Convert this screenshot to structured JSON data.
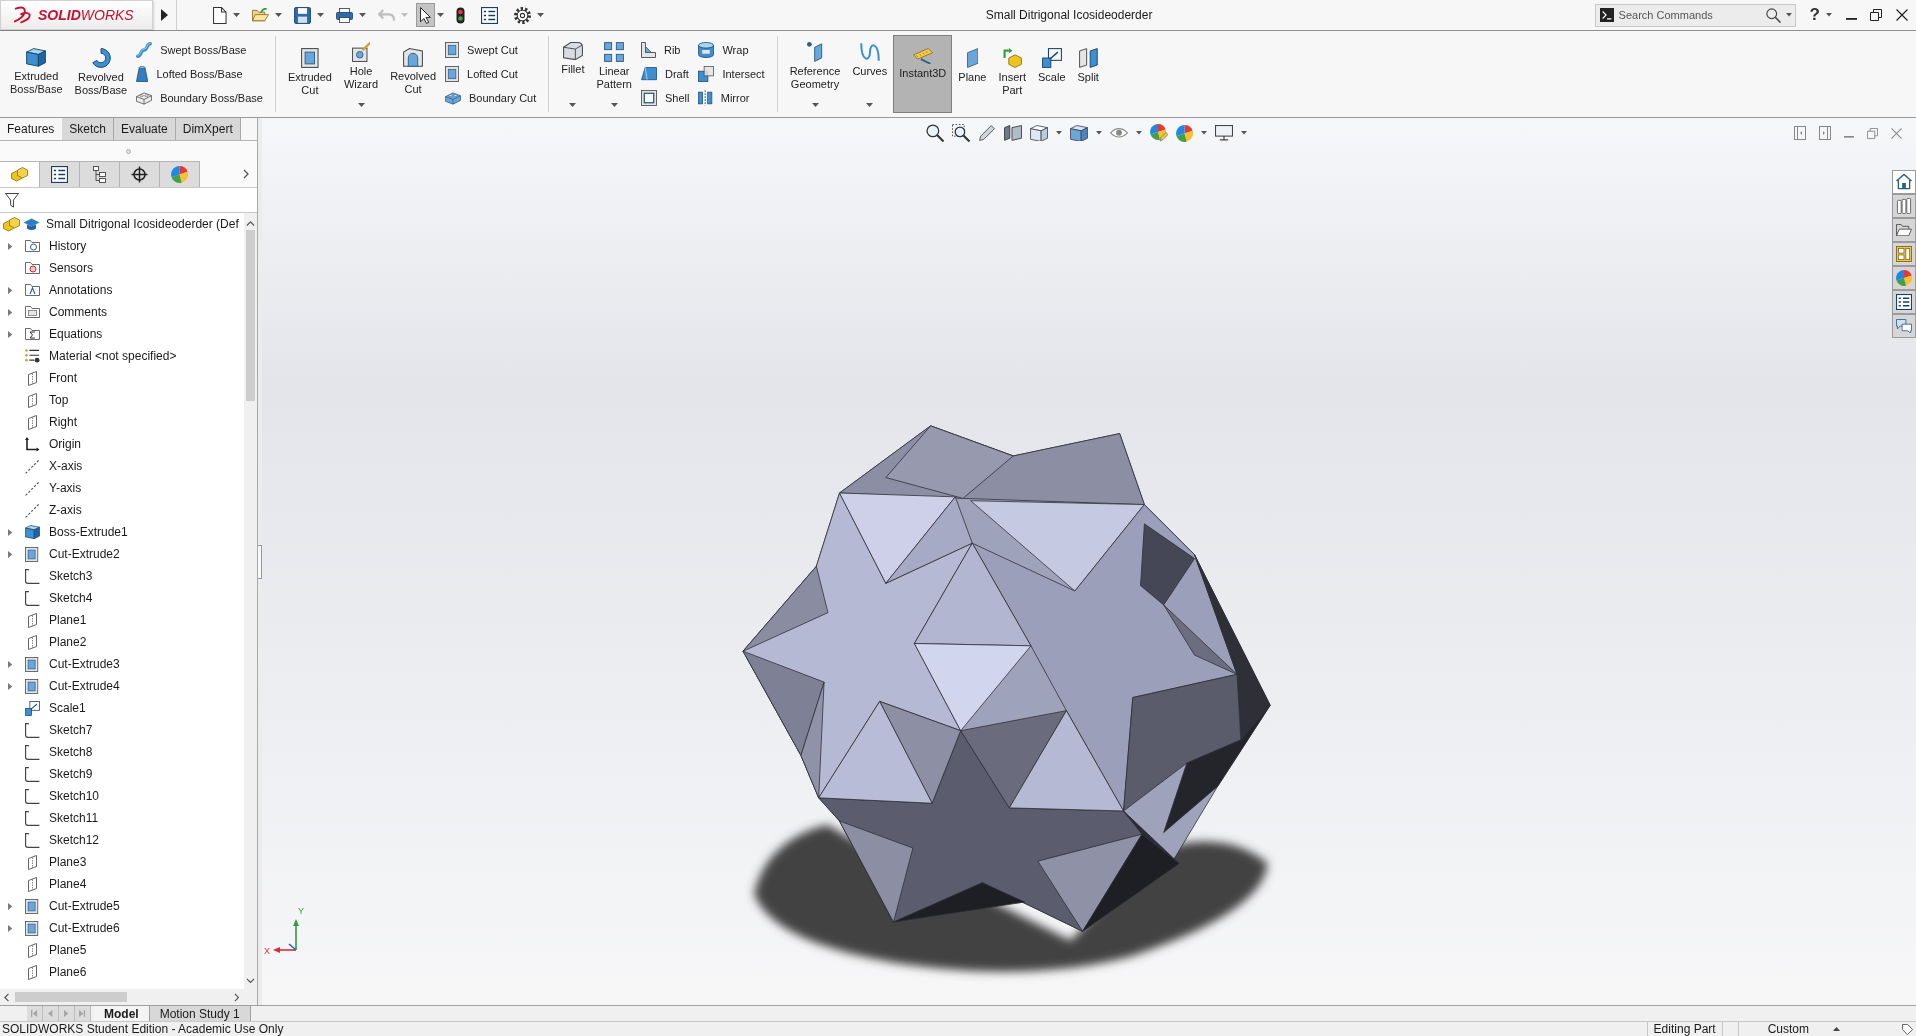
{
  "title_bar": {
    "logo_text": "**SOLID**WORKS",
    "document_title": "Small Ditrigonal Icosideoderder",
    "search": {
      "placeholder": "Search Commands"
    },
    "help": "?"
  },
  "quick_access": [
    {
      "kind": "new",
      "dropdown": true,
      "disabled": false,
      "selected": false
    },
    {
      "kind": "open",
      "dropdown": true,
      "disabled": false,
      "selected": false
    },
    {
      "kind": "save",
      "dropdown": true,
      "disabled": false,
      "selected": false
    },
    {
      "kind": "print",
      "dropdown": true,
      "disabled": false,
      "selected": false
    },
    {
      "kind": "undo",
      "dropdown": true,
      "disabled": true,
      "selected": false
    },
    {
      "kind": "select",
      "dropdown": true,
      "disabled": false,
      "selected": true
    },
    {
      "kind": "rebuild",
      "dropdown": false,
      "disabled": false,
      "selected": false
    },
    {
      "kind": "properties",
      "dropdown": false,
      "disabled": false,
      "selected": false
    },
    {
      "kind": "options",
      "dropdown": true,
      "disabled": false,
      "selected": false
    }
  ],
  "ribbon": [
    {
      "items": [
        {
          "kind": "large",
          "label": "Extruded Boss/Base",
          "dropdown": false,
          "selected": false
        },
        {
          "kind": "large",
          "label": "Revolved Boss/Base",
          "dropdown": false,
          "selected": false
        },
        {
          "kind": "stack",
          "items": [
            {
              "label": "Swept Boss/Base"
            },
            {
              "label": "Lofted Boss/Base"
            },
            {
              "label": "Boundary Boss/Base"
            }
          ]
        }
      ]
    },
    {
      "items": [
        {
          "kind": "large",
          "label": "Extruded Cut",
          "dropdown": false,
          "selected": false
        },
        {
          "kind": "large",
          "label": "Hole Wizard",
          "dropdown": true,
          "selected": false
        },
        {
          "kind": "large",
          "label": "Revolved Cut",
          "dropdown": false,
          "selected": false
        },
        {
          "kind": "stack",
          "items": [
            {
              "label": "Swept Cut"
            },
            {
              "label": "Lofted Cut"
            },
            {
              "label": "Boundary Cut"
            }
          ]
        }
      ]
    },
    {
      "items": [
        {
          "kind": "large",
          "label": "Fillet",
          "dropdown": true,
          "selected": false
        },
        {
          "kind": "large",
          "label": "Linear Pattern",
          "dropdown": true,
          "selected": false
        },
        {
          "kind": "stack",
          "items": [
            {
              "label": "Rib"
            },
            {
              "label": "Draft"
            },
            {
              "label": "Shell"
            }
          ]
        },
        {
          "kind": "stack",
          "items": [
            {
              "label": "Wrap"
            },
            {
              "label": "Intersect"
            },
            {
              "label": "Mirror"
            }
          ]
        }
      ]
    },
    {
      "items": [
        {
          "kind": "large",
          "label": "Reference Geometry",
          "dropdown": true,
          "selected": false
        },
        {
          "kind": "large",
          "label": "Curves",
          "dropdown": true,
          "selected": false
        },
        {
          "kind": "large",
          "label": "Instant3D",
          "dropdown": false,
          "selected": true
        },
        {
          "kind": "large",
          "label": "Plane",
          "dropdown": false,
          "selected": false
        },
        {
          "kind": "large",
          "label": "Insert Part",
          "dropdown": false,
          "selected": false
        },
        {
          "kind": "large",
          "label": "Scale",
          "dropdown": false,
          "selected": false
        },
        {
          "kind": "large",
          "label": "Split",
          "dropdown": false,
          "selected": false
        }
      ]
    }
  ],
  "command_tabs": [
    {
      "label": "Features",
      "selected": true
    },
    {
      "label": "Sketch",
      "selected": false
    },
    {
      "label": "Evaluate",
      "selected": false
    },
    {
      "label": "DimXpert",
      "selected": false
    }
  ],
  "panel_tabs": [
    {
      "selected": true
    },
    {
      "selected": false
    },
    {
      "selected": false
    },
    {
      "selected": false
    },
    {
      "selected": false
    }
  ],
  "feature_tree": {
    "label": "Small Ditrigonal Icosideoderder (Def",
    "children": [
      {
        "label": "History",
        "kind": "history",
        "expandable": true
      },
      {
        "label": "Sensors",
        "kind": "sensors",
        "expandable": false
      },
      {
        "label": "Annotations",
        "kind": "annotations",
        "expandable": true
      },
      {
        "label": "Comments",
        "kind": "comments",
        "expandable": true
      },
      {
        "label": "Equations",
        "kind": "equations",
        "expandable": true
      },
      {
        "label": "Material <not specified>",
        "kind": "material",
        "expandable": false
      },
      {
        "label": "Front",
        "kind": "plane",
        "expandable": false
      },
      {
        "label": "Top",
        "kind": "plane",
        "expandable": false
      },
      {
        "label": "Right",
        "kind": "plane",
        "expandable": false
      },
      {
        "label": "Origin",
        "kind": "origin",
        "expandable": false
      },
      {
        "label": "X-axis",
        "kind": "axis",
        "expandable": false
      },
      {
        "label": "Y-axis",
        "kind": "axis",
        "expandable": false
      },
      {
        "label": "Z-axis",
        "kind": "axis",
        "expandable": false
      },
      {
        "label": "Boss-Extrude1",
        "kind": "boss",
        "expandable": true
      },
      {
        "label": "Cut-Extrude2",
        "kind": "cut",
        "expandable": true
      },
      {
        "label": "Sketch3",
        "kind": "sketch",
        "expandable": false
      },
      {
        "label": "Sketch4",
        "kind": "sketch",
        "expandable": false
      },
      {
        "label": "Plane1",
        "kind": "plane",
        "expandable": false
      },
      {
        "label": "Plane2",
        "kind": "plane",
        "expandable": false
      },
      {
        "label": "Cut-Extrude3",
        "kind": "cut",
        "expandable": true
      },
      {
        "label": "Cut-Extrude4",
        "kind": "cut",
        "expandable": true
      },
      {
        "label": "Scale1",
        "kind": "scale",
        "expandable": false
      },
      {
        "label": "Sketch7",
        "kind": "sketch",
        "expandable": false
      },
      {
        "label": "Sketch8",
        "kind": "sketch",
        "expandable": false
      },
      {
        "label": "Sketch9",
        "kind": "sketch",
        "expandable": false
      },
      {
        "label": "Sketch10",
        "kind": "sketch",
        "expandable": false
      },
      {
        "label": "Sketch11",
        "kind": "sketch",
        "expandable": false
      },
      {
        "label": "Sketch12",
        "kind": "sketch",
        "expandable": false
      },
      {
        "label": "Plane3",
        "kind": "plane",
        "expandable": false
      },
      {
        "label": "Plane4",
        "kind": "plane",
        "expandable": false
      },
      {
        "label": "Cut-Extrude5",
        "kind": "cut",
        "expandable": true
      },
      {
        "label": "Cut-Extrude6",
        "kind": "cut",
        "expandable": true
      },
      {
        "label": "Plane5",
        "kind": "plane",
        "expandable": false
      },
      {
        "label": "Plane6",
        "kind": "plane",
        "expandable": false
      }
    ]
  },
  "triad": {
    "x_label": "X",
    "y_label": "Y"
  },
  "task_pane": [
    {
      "selected": true
    },
    {
      "selected": false
    },
    {
      "selected": false
    },
    {
      "selected": false
    },
    {
      "selected": false
    },
    {
      "selected": false
    },
    {
      "selected": false
    }
  ],
  "bottom_tabs": [
    {
      "label": "Model",
      "selected": true
    },
    {
      "label": "Motion Study 1",
      "selected": false
    }
  ],
  "status_bar": {
    "message": "SOLIDWORKS Student Edition - Academic Use Only",
    "mode": "Editing Part",
    "unit_system": "Custom"
  }
}
